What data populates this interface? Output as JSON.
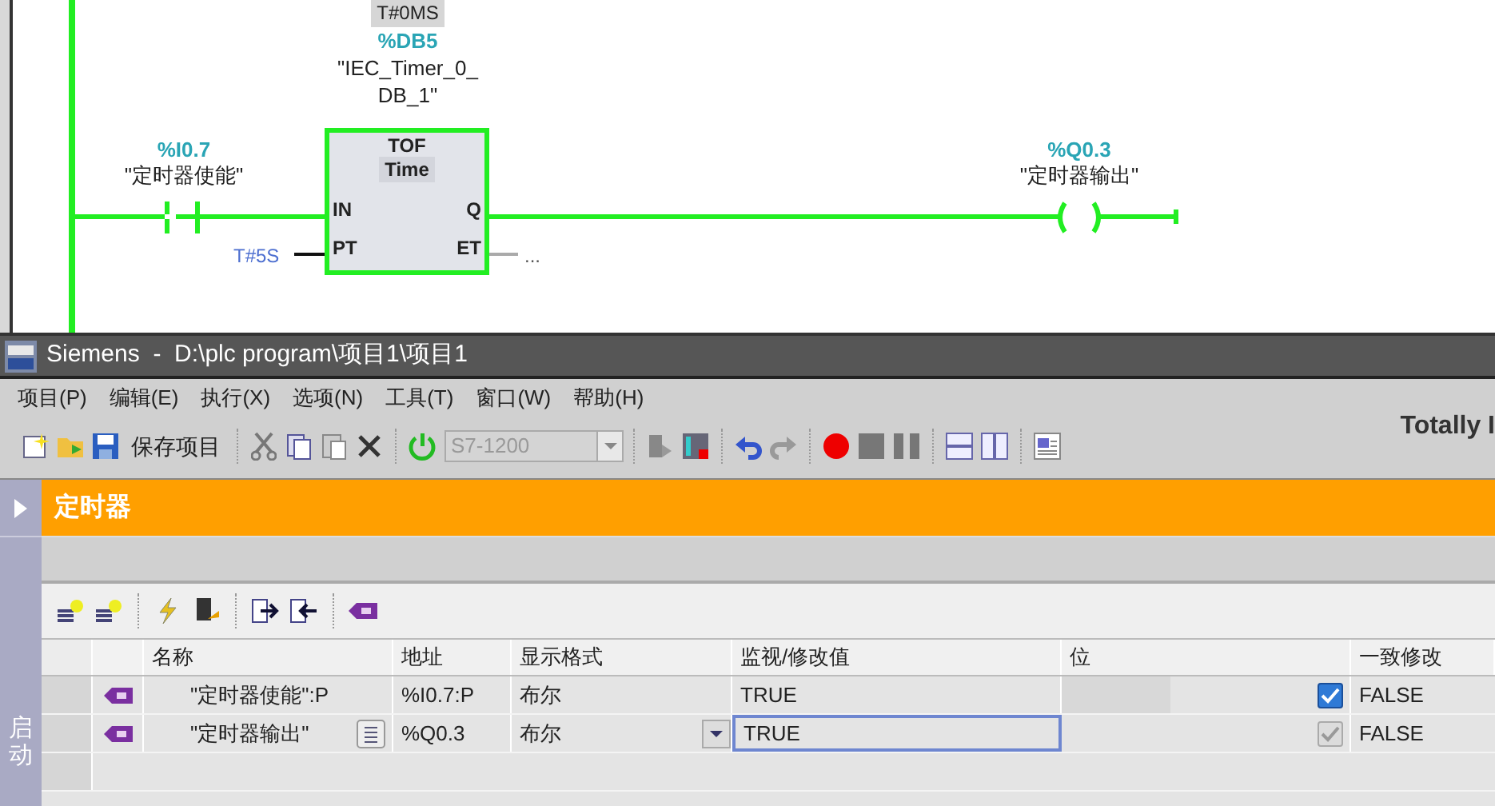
{
  "ladder": {
    "powered": true,
    "timer": {
      "preset_value": "T#0MS",
      "db_address": "%DB5",
      "instance_lines": [
        "\"IEC_Timer_0_",
        "DB_1\""
      ],
      "type": "TOF",
      "subtype": "Time",
      "pins": [
        "IN",
        "Q",
        "PT",
        "ET"
      ],
      "pt_value": "T#5S",
      "et_value": "..."
    },
    "contact": {
      "address": "%I0.7",
      "tag": "\"定时器使能\""
    },
    "coil": {
      "address": "%Q0.3",
      "tag": "\"定时器输出\""
    }
  },
  "window": {
    "title": "Siemens  -  D:\\plc program\\项目1\\项目1",
    "right_text": "Totally I"
  },
  "menu": [
    "项目(P)",
    "编辑(E)",
    "执行(X)",
    "选项(N)",
    "工具(T)",
    "窗口(W)",
    "帮助(H)"
  ],
  "toolbar": {
    "save_label": "保存项目",
    "cpu_select": {
      "value": "S7-1200",
      "disabled": true
    }
  },
  "section": {
    "title": "定时器",
    "side_label": "启动"
  },
  "table": {
    "columns": [
      "名称",
      "地址",
      "显示格式",
      "监视/修改值",
      "位",
      "一致修改"
    ],
    "rows": [
      {
        "name": "\"定时器使能\":P",
        "address": "%I0.7:P",
        "format": "布尔",
        "value": "TRUE",
        "selected": false,
        "checked": true,
        "check_disabled": false,
        "modify": "FALSE"
      },
      {
        "name": "\"定时器输出\"",
        "address": "%Q0.3",
        "format": "布尔",
        "value": "TRUE",
        "selected": true,
        "checked": true,
        "check_disabled": true,
        "modify": "FALSE"
      }
    ]
  }
}
